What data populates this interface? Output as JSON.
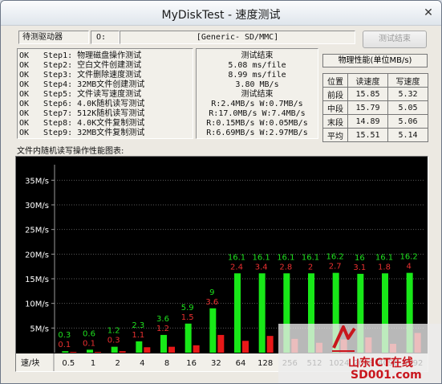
{
  "window": {
    "title": "MyDiskTest - 速度测试",
    "close_glyph": "✕"
  },
  "top": {
    "driver_label": "待测驱动器",
    "drive_letter": "O:",
    "drive_name": "[Generic- SD/MMC]",
    "test_button": "测试结束"
  },
  "steps": [
    {
      "status": "OK",
      "text": "Step1: 物理磁盘操作测试"
    },
    {
      "status": "OK",
      "text": "Step2: 空白文件创建测试"
    },
    {
      "status": "OK",
      "text": "Step3: 文件删除速度测试"
    },
    {
      "status": "OK",
      "text": "Step4: 32MB文件创建测试"
    },
    {
      "status": "OK",
      "text": "Step5: 文件读写速度测试"
    },
    {
      "status": "OK",
      "text": "Step6: 4.0K随机读写测试"
    },
    {
      "status": "OK",
      "text": "Step7: 512K随机读写测试"
    },
    {
      "status": "OK",
      "text": "Step8: 4.0K文件复制测试"
    },
    {
      "status": "OK",
      "text": "Step9: 32MB文件复制测试"
    }
  ],
  "results": [
    "测试结束",
    "5.08 ms/file",
    "8.99 ms/file",
    "3.80 MB/s",
    "测试结束",
    "R:2.4MB/s W:0.7MB/s",
    "R:17.0MB/s W:7.4MB/s",
    "R:0.15MB/s W:0.05MB/s",
    "R:6.69MB/s W:2.97MB/s"
  ],
  "perf": {
    "header": "物理性能(单位MB/s)",
    "columns": [
      "位置",
      "读速度",
      "写速度"
    ],
    "rows": [
      [
        "前段",
        "15.85",
        "5.32"
      ],
      [
        "中段",
        "15.79",
        "5.05"
      ],
      [
        "末段",
        "14.89",
        "5.06"
      ],
      [
        "平均",
        "15.51",
        "5.14"
      ]
    ]
  },
  "chart_caption": "文件内随机读写操作性能图表:",
  "chart_data": {
    "type": "bar",
    "xlabel": "速/块",
    "categories": [
      "0.5",
      "1",
      "2",
      "4",
      "8",
      "16",
      "32",
      "64",
      "128",
      "256",
      "512",
      "1024",
      "2048",
      "4096",
      "8192"
    ],
    "ylim": [
      0,
      37.5
    ],
    "yticks": [
      "5M/s",
      "10M/s",
      "15M/s",
      "20M/s",
      "25M/s",
      "30M/s",
      "35M/s"
    ],
    "series": [
      {
        "values": [
          0.3,
          0.6,
          1.2,
          2.3,
          3.6,
          5.9,
          9.0,
          16.1,
          16.1,
          16.1,
          16.1,
          16.2,
          16.0,
          16.1,
          16.2
        ],
        "color": "#18e818",
        "label_color": "#1ee01e"
      },
      {
        "values": [
          0.1,
          0.1,
          0.3,
          1.1,
          1.2,
          1.5,
          3.6,
          2.4,
          3.4,
          2.8,
          2.0,
          2.7,
          3.1,
          1.8,
          4.0
        ],
        "color": "#e81818",
        "label_color": "#e83030"
      }
    ],
    "labels_visible": [
      true,
      true,
      true,
      true,
      true,
      true,
      true,
      true,
      true,
      true,
      true,
      true,
      true,
      true,
      true
    ],
    "grid": true
  },
  "watermark": {
    "site": "山东ICT在线",
    "domain": "SD001.com"
  }
}
